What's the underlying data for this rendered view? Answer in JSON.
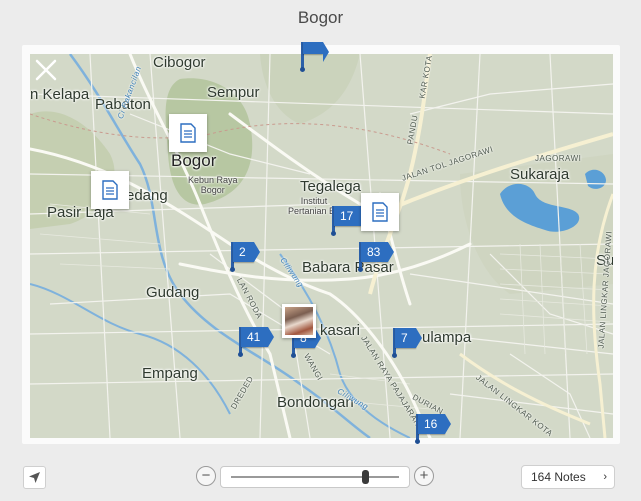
{
  "window": {
    "title": "Bogor"
  },
  "map": {
    "places": [
      {
        "id": "cibogor",
        "label": "Cibogor"
      },
      {
        "id": "sempur",
        "label": "Sempur"
      },
      {
        "id": "kelapa",
        "label": "n Kelapa"
      },
      {
        "id": "pabaton",
        "label": "Pabaton"
      },
      {
        "id": "bogor",
        "label": "Bogor"
      },
      {
        "id": "kebun",
        "label": "Kebun Raya\nBogor"
      },
      {
        "id": "tegalega",
        "label": "Tegalega"
      },
      {
        "id": "institut",
        "label": "Institut\nPertanian Bo"
      },
      {
        "id": "sukaraja",
        "label": "Sukaraja"
      },
      {
        "id": "pasir-laja",
        "label": "Pasir Laja"
      },
      {
        "id": "edang",
        "label": "edang"
      },
      {
        "id": "babara",
        "label": "Babara Pasar"
      },
      {
        "id": "gudang",
        "label": "Gudang"
      },
      {
        "id": "kasari",
        "label": "kasari"
      },
      {
        "id": "ulampa",
        "label": "ulampa"
      },
      {
        "id": "empang",
        "label": "Empang"
      },
      {
        "id": "bondongan",
        "label": "Bondongan"
      },
      {
        "id": "su",
        "label": "Su"
      }
    ],
    "road_labels": [
      {
        "id": "jagorawi-top",
        "label": "JAGORAWI"
      },
      {
        "id": "tol-jagorawi",
        "label": "JALAN TOL JAGORAWI"
      },
      {
        "id": "pandu",
        "label": "PANDU"
      },
      {
        "id": "kar-kota",
        "label": "KAR KOTA"
      },
      {
        "id": "lan-roda",
        "label": "LAN RODA"
      },
      {
        "id": "jalan-raya",
        "label": "JALAN RAYA PAJAJARAN"
      },
      {
        "id": "lingkar",
        "label": "JALAN LINGKAR KOTA"
      },
      {
        "id": "durian",
        "label": "DURIAN"
      },
      {
        "id": "dreded",
        "label": "DREDED"
      },
      {
        "id": "wangi",
        "label": "WANGI"
      },
      {
        "id": "lingkar-right",
        "label": "JALAN LINGKAR JAGORAWI"
      },
      {
        "id": "ciliwung-1",
        "label": "Ciliwung"
      },
      {
        "id": "ciliwung-2",
        "label": "Ciliwung"
      },
      {
        "id": "cipakancilan",
        "label": "Ci Pakancilan"
      }
    ],
    "clusters": [
      {
        "id": "c2",
        "count": "2"
      },
      {
        "id": "c17",
        "count": "17"
      },
      {
        "id": "c83",
        "count": "83"
      },
      {
        "id": "c41",
        "count": "41"
      },
      {
        "id": "c8",
        "count": "8"
      },
      {
        "id": "c7",
        "count": "7"
      },
      {
        "id": "c16",
        "count": "16"
      },
      {
        "id": "ctop",
        "count": ""
      }
    ],
    "note_markers": 3,
    "photo_markers": 1
  },
  "toolbar": {
    "zoom_out": "−",
    "zoom_in": "+",
    "zoom_level": 0.8,
    "notes_label": "164 Notes",
    "notes_chevron": "›"
  },
  "icons": {
    "close": "close-icon",
    "locate": "location-arrow-icon",
    "note": "note-document-icon"
  },
  "colors": {
    "marker_blue": "#2d6ec0",
    "map_land": "#d3d9c8",
    "water": "#5b9fd6",
    "background": "#ececec"
  }
}
